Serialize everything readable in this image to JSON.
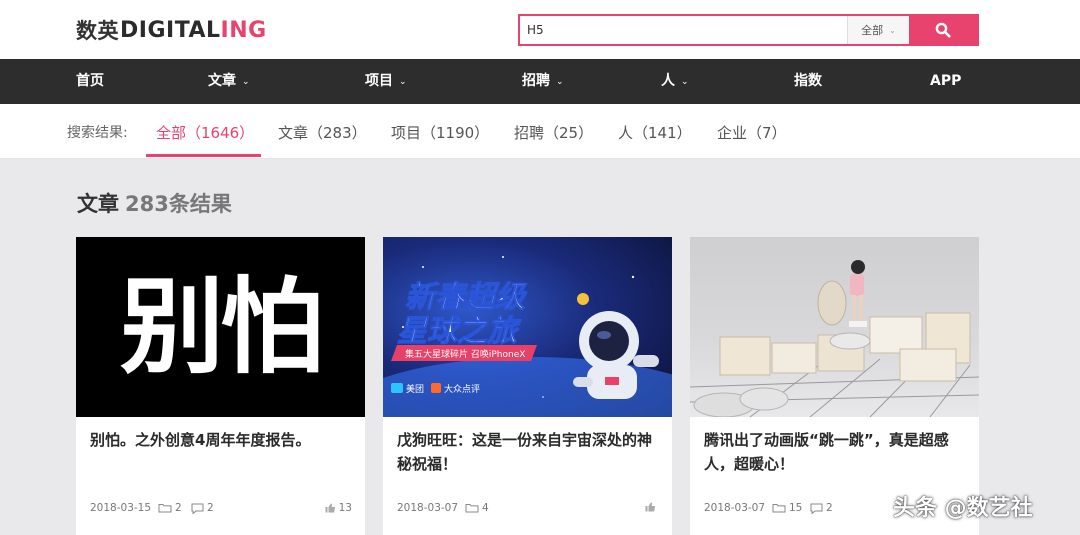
{
  "logo": {
    "cn": "数英",
    "en_main": "DIGITAL",
    "en_accent": "ING"
  },
  "search": {
    "value": "H5",
    "scope": "全部"
  },
  "nav": [
    {
      "label": "首页"
    },
    {
      "label": "文章"
    },
    {
      "label": "项目"
    },
    {
      "label": "招聘"
    },
    {
      "label": "人"
    },
    {
      "label": "指数"
    },
    {
      "label": "APP"
    }
  ],
  "results": {
    "label": "搜索结果:",
    "tabs": [
      {
        "label": "全部（1646）"
      },
      {
        "label": "文章（283）"
      },
      {
        "label": "项目（1190）"
      },
      {
        "label": "招聘（25）"
      },
      {
        "label": "人（141）"
      },
      {
        "label": "企业（7）"
      }
    ]
  },
  "section": {
    "title": "文章",
    "count": "283条结果"
  },
  "cards": [
    {
      "image_text": "别怕",
      "title": "别怕。之外创意4周年年度报告。",
      "date": "2018-03-15",
      "folder_count": "2",
      "comment_count": "2",
      "likes": "13"
    },
    {
      "image_text": {
        "line1": "新春超级",
        "line2": "星球之旅",
        "ribbon": "集五大星球碎片 召唤iPhoneX",
        "brand1": "美团",
        "brand2": "大众点评"
      },
      "title": "戊狗旺旺：这是一份来自宇宙深处的神秘祝福！",
      "date": "2018-03-07",
      "folder_count": "4",
      "comment_count": "",
      "likes": ""
    },
    {
      "image_text": "",
      "title": "腾讯出了动画版“跳一跳”，真是超感人，超暖心！",
      "date": "2018-03-07",
      "folder_count": "15",
      "comment_count": "2",
      "likes": ""
    }
  ],
  "watermark": "头条 @数艺社",
  "colors": {
    "accent": "#e8436e",
    "nav_bg": "#2d2d2d",
    "page_bg": "#e9e9ec"
  }
}
